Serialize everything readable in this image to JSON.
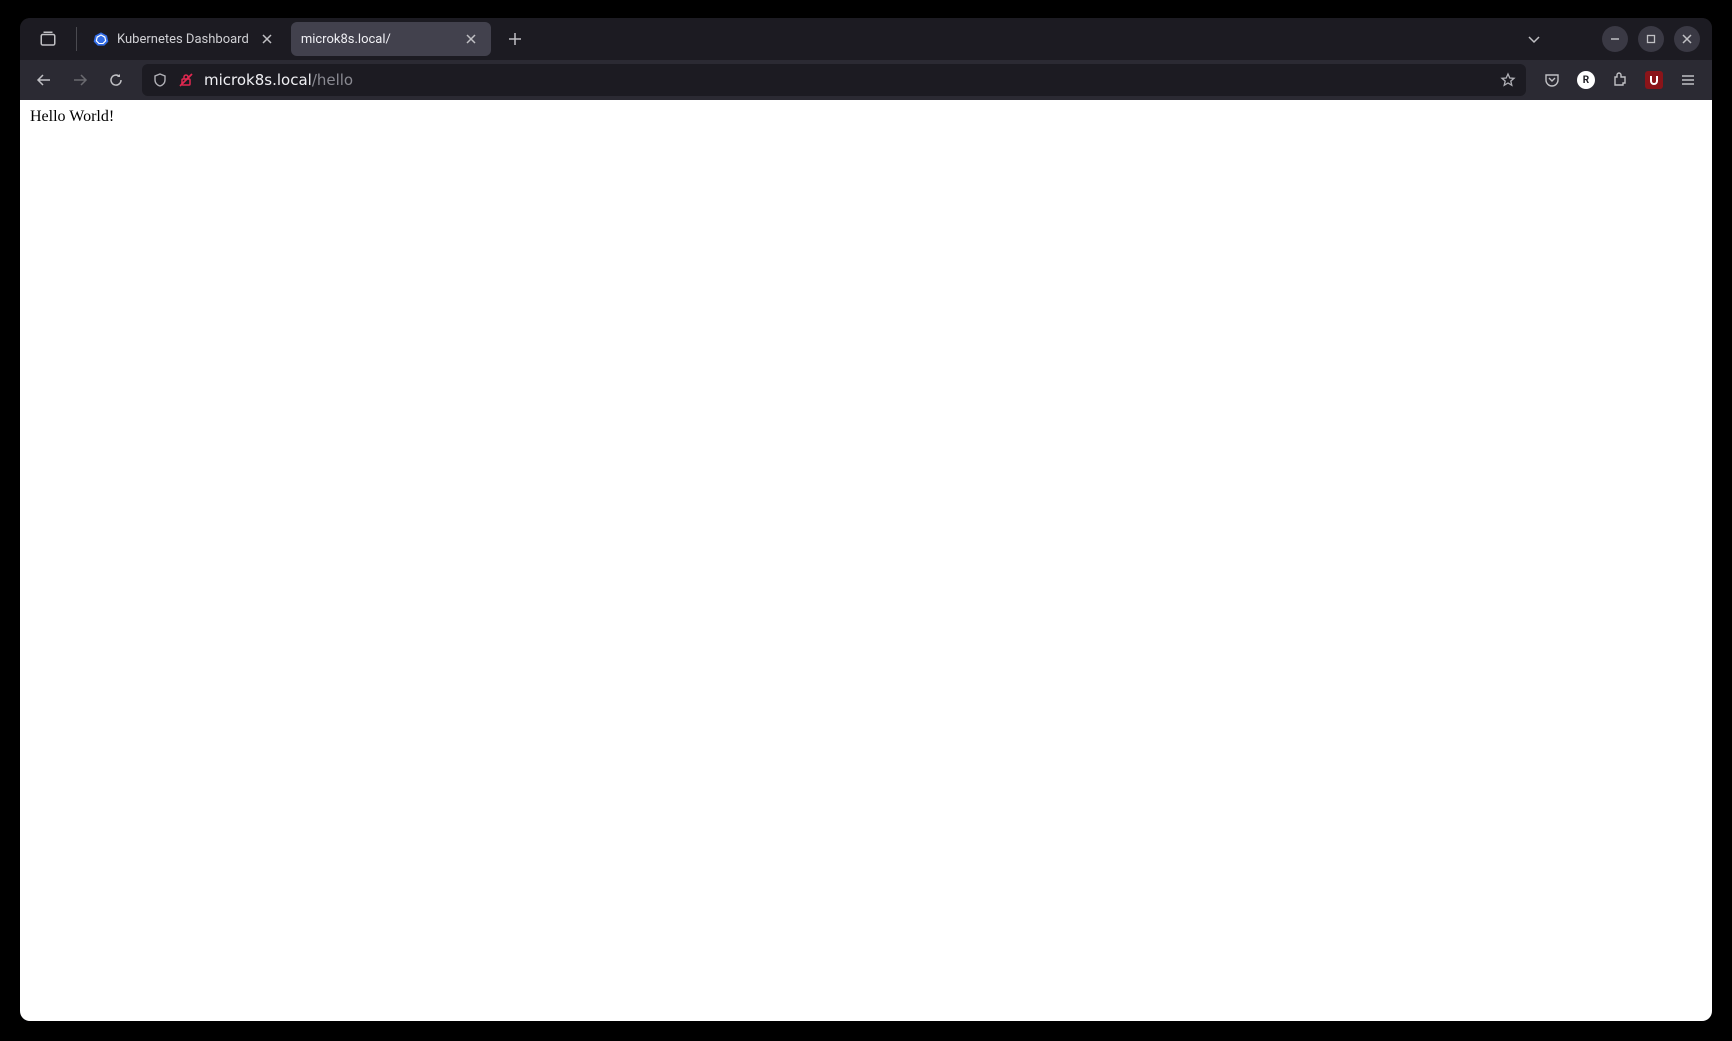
{
  "tabs": [
    {
      "title": "Kubernetes Dashboard",
      "active": false,
      "favicon": "kubernetes"
    },
    {
      "title": "microk8s.local/",
      "active": true,
      "favicon": "none"
    }
  ],
  "url": {
    "host": "microk8s.local",
    "path": "/hello"
  },
  "toolbar": {
    "reader_badge": "R",
    "ublock_badge": "u"
  },
  "page": {
    "body_text": "Hello World!"
  }
}
